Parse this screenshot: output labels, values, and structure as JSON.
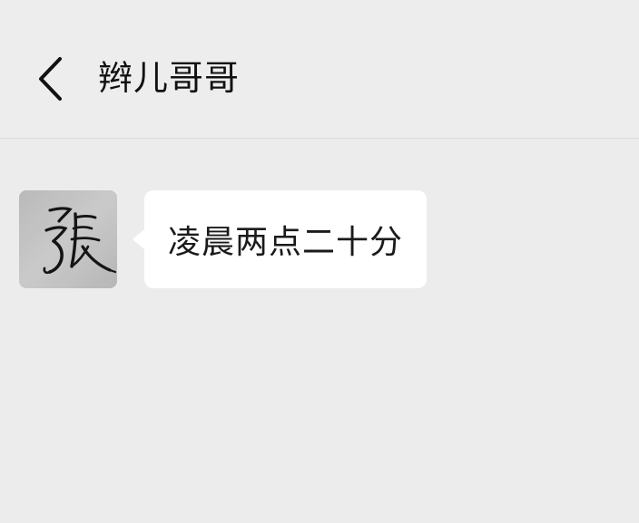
{
  "header": {
    "back_icon": "chevron-left-icon",
    "title": "辫儿哥哥"
  },
  "messages": [
    {
      "sender": "contact",
      "avatar": {
        "type": "calligraphy-signature",
        "text": "張"
      },
      "text": "凌晨两点二十分"
    }
  ],
  "colors": {
    "background": "#ececec",
    "bubble": "#ffffff",
    "text": "#1a1a1a"
  }
}
